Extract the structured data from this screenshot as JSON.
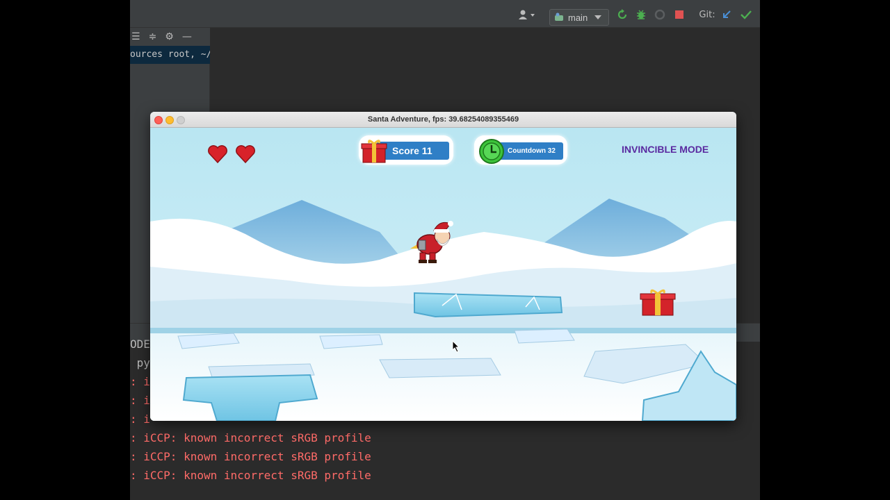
{
  "toolbar": {
    "user_icon": "user-icon",
    "branch_label": "main",
    "git_label": "Git:",
    "colors": {
      "rerun": "#4caf50",
      "debug": "#4caf50",
      "stop": "#e05252",
      "git_update": "#4a8fd6",
      "git_commit": "#4caf50"
    }
  },
  "project_panel": {
    "path_text": "ources root, ~/Do"
  },
  "console": {
    "fragment_1": "ODE",
    "fragment_2": " py",
    "fragment_3": ": i",
    "fragment_4": ": i",
    "fragment_5": ": i",
    "line_1": ": iCCP: known incorrect sRGB profile",
    "line_2": ": iCCP: known incorrect sRGB profile",
    "line_3": ": iCCP: known incorrect sRGB profile"
  },
  "game_window": {
    "title": "Santa Adventure, fps: 39.68254089355469",
    "hud": {
      "lives": 2,
      "score_label": "Score 11",
      "countdown_label": "Countdown 32",
      "mode_label": "INVINCIBLE MODE"
    },
    "colors": {
      "sky": "#b9e6f2",
      "mountain": "#7fb8db",
      "snow": "#ffffff",
      "ice": "#8fd3ee",
      "hud_bar": "#2f7fc6",
      "mode_text": "#5a2aa0"
    }
  }
}
